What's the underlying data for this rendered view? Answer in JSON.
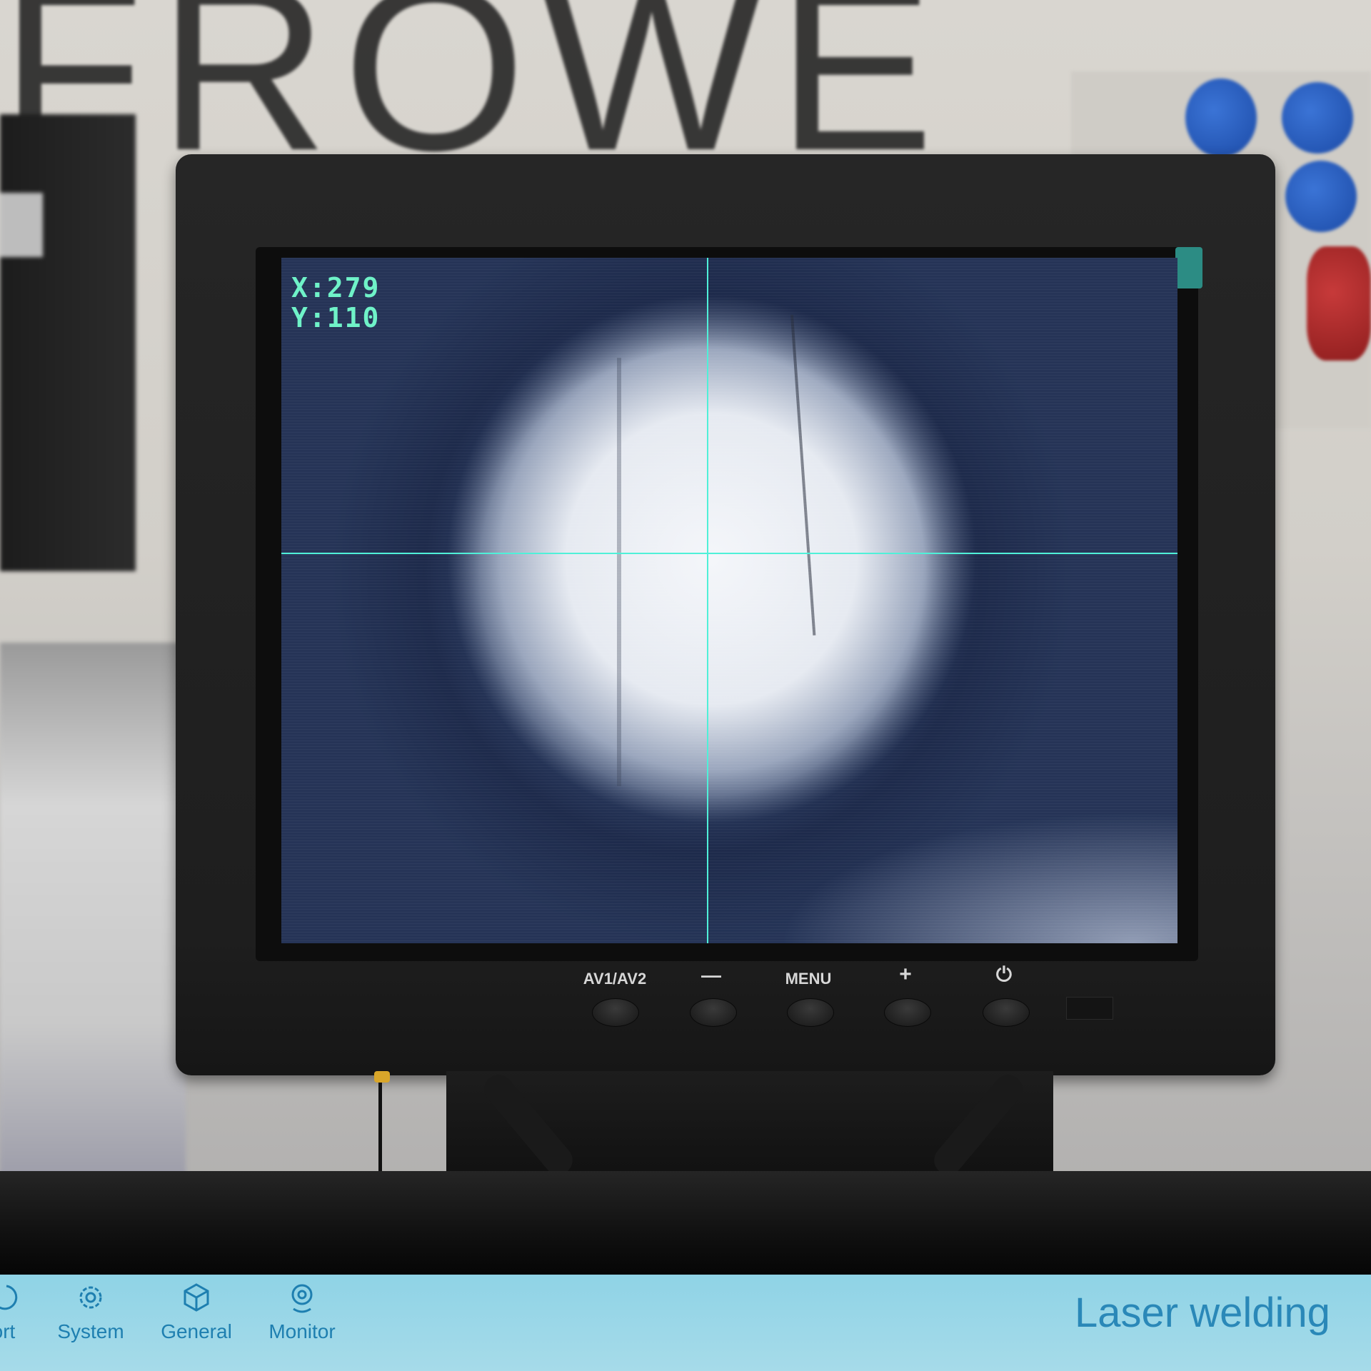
{
  "wall": {
    "letters": "FROWE"
  },
  "camera_screen": {
    "x_readout": "X:279",
    "y_readout": "Y:110",
    "crosshair_color": "#4ff0d8"
  },
  "monitor_buttons": {
    "input": "AV1/AV2",
    "minus": "—",
    "menu": "MENU",
    "plus": "+",
    "power": "⏻"
  },
  "hmi": {
    "nav_items": [
      {
        "label": "ort"
      },
      {
        "label": "System"
      },
      {
        "label": "General"
      },
      {
        "label": "Monitor"
      }
    ],
    "title": "Laser welding",
    "accent": "#1e7fb0"
  }
}
